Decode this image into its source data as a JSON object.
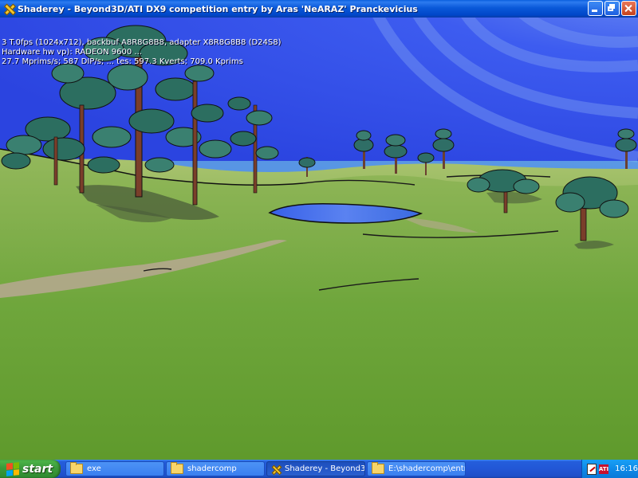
{
  "window": {
    "title": "Shaderey - Beyond3D/ATI DX9 competition entry by Aras 'NeARAZ' Pranckevicius",
    "buttons": [
      "minimize",
      "maximize",
      "close"
    ]
  },
  "overlay": {
    "line1": "3 T.0fps (1024x712), backbuf A8R8G8B8, adapter X8R8G8B8 (D24S8)",
    "line2": "Hardware hw vp): RADEON 9600 ...",
    "line3": "27.7 Mprims/s;  587 DIP/s;  ... tes:  597.3 Kverts;  709.0 Kprims"
  },
  "taskbar": {
    "start_label": "start",
    "tasks": [
      {
        "label": "exe",
        "icon": "folder-icon",
        "active": false
      },
      {
        "label": "shadercomp",
        "icon": "folder-icon",
        "active": false
      },
      {
        "label": "Shaderey - Beyond3...",
        "icon": "shaderey-app-icon",
        "active": true
      },
      {
        "label": "E:\\shadercomp\\entrie...",
        "icon": "folder-icon",
        "active": false
      }
    ],
    "tray_icons": [
      "display-settings-icon",
      "ati-icon"
    ],
    "tray_ati_text": "ATI",
    "clock": "16:16"
  },
  "colors": {
    "titlebar": "#0a58d8",
    "sky": "#2a40d8",
    "grass": "#6aa83a",
    "start_green": "#3c9c3c"
  }
}
